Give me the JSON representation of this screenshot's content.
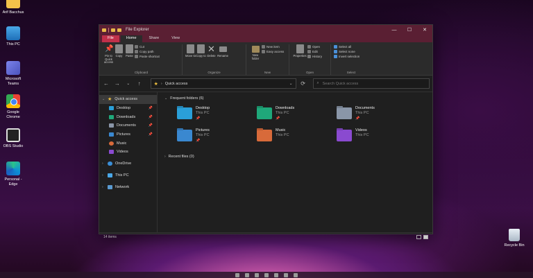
{
  "desktop": {
    "icons": [
      {
        "label": "Arif Bacchus",
        "icon": "user-folder-icon"
      },
      {
        "label": "This PC",
        "icon": "computer-icon"
      },
      {
        "label": "Microsoft Teams",
        "icon": "teams-icon"
      },
      {
        "label": "Google Chrome",
        "icon": "chrome-icon"
      },
      {
        "label": "OBS Studio",
        "icon": "obs-icon"
      },
      {
        "label": "Personal - Edge",
        "icon": "edge-icon"
      }
    ],
    "recycle_bin": "Recycle Bin"
  },
  "window": {
    "title": "File Explorer",
    "controls": {
      "minimize": "—",
      "maximize": "☐",
      "close": "✕"
    }
  },
  "ribbon": {
    "tabs": [
      "File",
      "Home",
      "Share",
      "View"
    ],
    "active_tab": "Home",
    "clipboard": {
      "label": "Clipboard",
      "pin": "Pin to Quick access",
      "copy": "Copy",
      "paste": "Paste",
      "cut": "Cut",
      "copy_path": "Copy path",
      "paste_shortcut": "Paste shortcut"
    },
    "organize": {
      "label": "Organize",
      "move_to": "Move to",
      "copy_to": "Copy to",
      "delete": "Delete",
      "rename": "Rename"
    },
    "new": {
      "label": "New",
      "new_folder": "New folder",
      "new_item": "New item",
      "easy_access": "Easy access"
    },
    "open": {
      "label": "Open",
      "properties": "Properties",
      "open": "Open",
      "edit": "Edit",
      "history": "History"
    },
    "select": {
      "label": "Select",
      "select_all": "Select all",
      "select_none": "Select none",
      "invert": "Invert selection"
    }
  },
  "addressbar": {
    "path": "Quick access",
    "search_placeholder": "Search Quick access"
  },
  "navpane": {
    "quick_access": "Quick access",
    "quick_items": [
      {
        "label": "Desktop",
        "color": "#2a9fd8",
        "pinned": true
      },
      {
        "label": "Downloads",
        "color": "#1fa87a",
        "pinned": true
      },
      {
        "label": "Documents",
        "color": "#8a96a8",
        "pinned": true
      },
      {
        "label": "Pictures",
        "color": "#3a88d0",
        "pinned": true
      },
      {
        "label": "Music",
        "color": "#d86a3a",
        "pinned": false
      },
      {
        "label": "Videos",
        "color": "#8a4ad0",
        "pinned": false
      }
    ],
    "onedrive": "OneDrive",
    "this_pc": "This PC",
    "network": "Network"
  },
  "main": {
    "frequent_header": "Frequent folders (6)",
    "folders": [
      {
        "name": "Desktop",
        "location": "This PC",
        "class": "f-desktop"
      },
      {
        "name": "Downloads",
        "location": "This PC",
        "class": "f-downloads"
      },
      {
        "name": "Documents",
        "location": "This PC",
        "class": "f-documents"
      },
      {
        "name": "Pictures",
        "location": "This PC",
        "class": "f-pictures"
      },
      {
        "name": "Music",
        "location": "This PC",
        "class": "f-music"
      },
      {
        "name": "Videos",
        "location": "This PC",
        "class": "f-videos"
      }
    ],
    "recent_header": "Recent files (0)"
  },
  "status": {
    "item_count": "14 items"
  },
  "colors": {
    "titlebar": "#5a1f33",
    "file_tab": "#c0304a",
    "window_bg": "#1f1f1f"
  }
}
